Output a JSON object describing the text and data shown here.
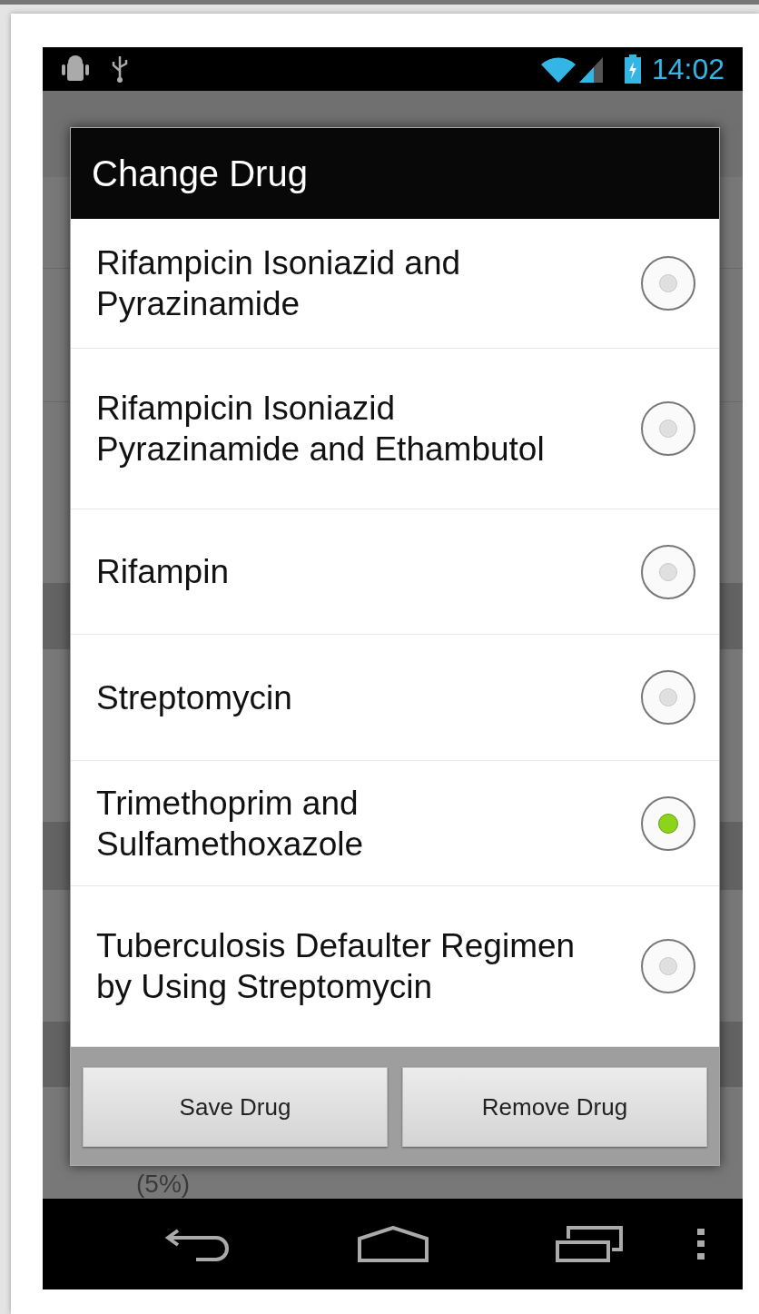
{
  "status_bar": {
    "time": "14:02"
  },
  "background": {
    "text": "(5%)"
  },
  "dialog": {
    "title": "Change Drug",
    "options": [
      {
        "label": "Rifampicin Isoniazid and Pyrazinamide",
        "selected": false
      },
      {
        "label": "Rifampicin Isoniazid Pyrazinamide and Ethambutol",
        "selected": false
      },
      {
        "label": "Rifampin",
        "selected": false
      },
      {
        "label": "Streptomycin",
        "selected": false
      },
      {
        "label": "Trimethoprim and Sulfamethoxazole",
        "selected": true
      },
      {
        "label": "Tuberculosis Defaulter Regimen by Using Streptomycin",
        "selected": false
      }
    ],
    "buttons": [
      "Save Drug",
      "Remove Drug"
    ]
  }
}
